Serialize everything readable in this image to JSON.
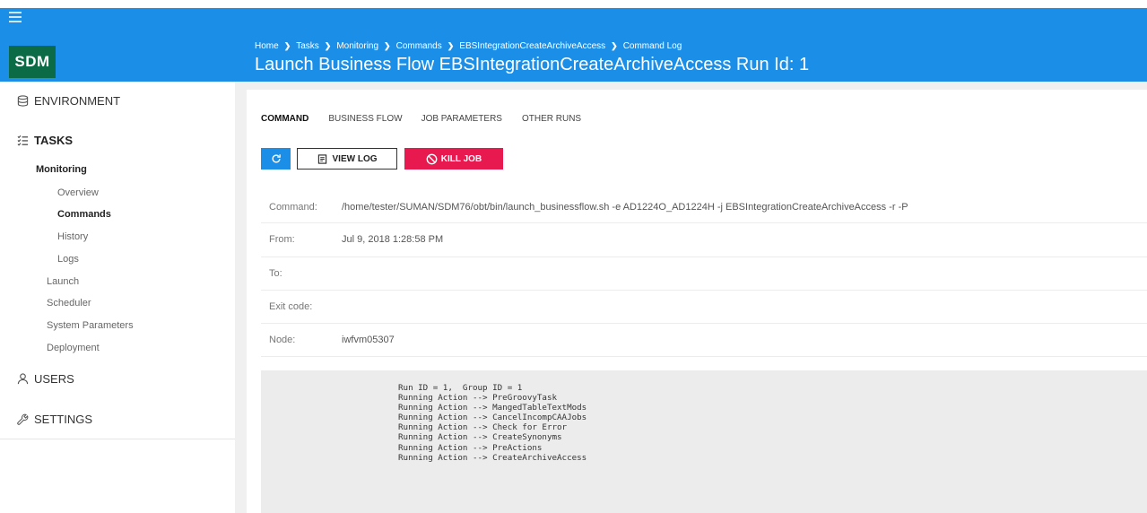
{
  "header": {
    "logo": "SDM",
    "breadcrumb": [
      "Home",
      "Tasks",
      "Monitoring",
      "Commands",
      "EBSIntegrationCreateArchiveAccess",
      "Command Log"
    ],
    "title": "Launch Business Flow EBSIntegrationCreateArchiveAccess Run Id: 1"
  },
  "sidebar": {
    "environment": "ENVIRONMENT",
    "tasks": "TASKS",
    "monitoring": "Monitoring",
    "overview": "Overview",
    "commands": "Commands",
    "history": "History",
    "logs": "Logs",
    "launch": "Launch",
    "scheduler": "Scheduler",
    "system_parameters": "System Parameters",
    "deployment": "Deployment",
    "users": "USERS",
    "settings": "SETTINGS"
  },
  "tabs": [
    "COMMAND",
    "BUSINESS FLOW",
    "JOB PARAMETERS",
    "OTHER RUNS"
  ],
  "toolbar": {
    "view_log": "VIEW LOG",
    "kill_job": "KILL JOB"
  },
  "details": {
    "command_label": "Command:",
    "command_value": "/home/tester/SUMAN/SDM76/obt/bin/launch_businessflow.sh -e AD1224O_AD1224H -j EBSIntegrationCreateArchiveAccess -r -P",
    "from_label": "From:",
    "from_value": "Jul 9, 2018 1:28:58 PM",
    "to_label": "To:",
    "to_value": "",
    "exit_label": "Exit code:",
    "exit_value": "",
    "node_label": "Node:",
    "node_value": "iwfvm05307"
  },
  "log": {
    "text": "Run ID = 1,  Group ID = 1\nRunning Action --> PreGroovyTask\nRunning Action --> MangedTableTextMods\nRunning Action --> CancelIncompCAAJobs\nRunning Action --> Check for Error\nRunning Action --> CreateSynonyms\nRunning Action --> PreActions\nRunning Action --> CreateArchiveAccess"
  },
  "colors": {
    "header": "#1b8fe8",
    "logo_bg": "#0a6b46",
    "kill": "#e8194e",
    "log_bg": "#ececec"
  }
}
